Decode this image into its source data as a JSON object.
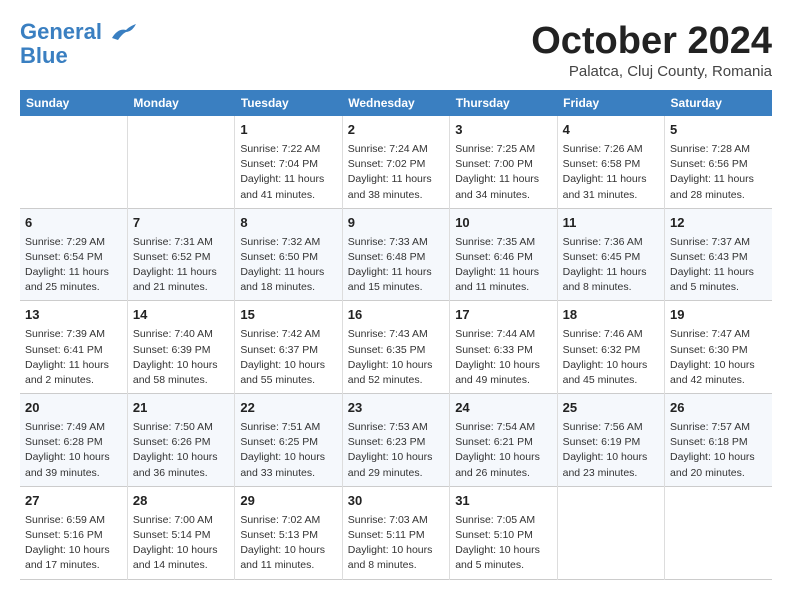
{
  "header": {
    "logo_line1": "General",
    "logo_line2": "Blue",
    "month": "October 2024",
    "location": "Palatca, Cluj County, Romania"
  },
  "weekdays": [
    "Sunday",
    "Monday",
    "Tuesday",
    "Wednesday",
    "Thursday",
    "Friday",
    "Saturday"
  ],
  "weeks": [
    [
      {
        "day": "",
        "info": ""
      },
      {
        "day": "",
        "info": ""
      },
      {
        "day": "1",
        "info": "Sunrise: 7:22 AM\nSunset: 7:04 PM\nDaylight: 11 hours and 41 minutes."
      },
      {
        "day": "2",
        "info": "Sunrise: 7:24 AM\nSunset: 7:02 PM\nDaylight: 11 hours and 38 minutes."
      },
      {
        "day": "3",
        "info": "Sunrise: 7:25 AM\nSunset: 7:00 PM\nDaylight: 11 hours and 34 minutes."
      },
      {
        "day": "4",
        "info": "Sunrise: 7:26 AM\nSunset: 6:58 PM\nDaylight: 11 hours and 31 minutes."
      },
      {
        "day": "5",
        "info": "Sunrise: 7:28 AM\nSunset: 6:56 PM\nDaylight: 11 hours and 28 minutes."
      }
    ],
    [
      {
        "day": "6",
        "info": "Sunrise: 7:29 AM\nSunset: 6:54 PM\nDaylight: 11 hours and 25 minutes."
      },
      {
        "day": "7",
        "info": "Sunrise: 7:31 AM\nSunset: 6:52 PM\nDaylight: 11 hours and 21 minutes."
      },
      {
        "day": "8",
        "info": "Sunrise: 7:32 AM\nSunset: 6:50 PM\nDaylight: 11 hours and 18 minutes."
      },
      {
        "day": "9",
        "info": "Sunrise: 7:33 AM\nSunset: 6:48 PM\nDaylight: 11 hours and 15 minutes."
      },
      {
        "day": "10",
        "info": "Sunrise: 7:35 AM\nSunset: 6:46 PM\nDaylight: 11 hours and 11 minutes."
      },
      {
        "day": "11",
        "info": "Sunrise: 7:36 AM\nSunset: 6:45 PM\nDaylight: 11 hours and 8 minutes."
      },
      {
        "day": "12",
        "info": "Sunrise: 7:37 AM\nSunset: 6:43 PM\nDaylight: 11 hours and 5 minutes."
      }
    ],
    [
      {
        "day": "13",
        "info": "Sunrise: 7:39 AM\nSunset: 6:41 PM\nDaylight: 11 hours and 2 minutes."
      },
      {
        "day": "14",
        "info": "Sunrise: 7:40 AM\nSunset: 6:39 PM\nDaylight: 10 hours and 58 minutes."
      },
      {
        "day": "15",
        "info": "Sunrise: 7:42 AM\nSunset: 6:37 PM\nDaylight: 10 hours and 55 minutes."
      },
      {
        "day": "16",
        "info": "Sunrise: 7:43 AM\nSunset: 6:35 PM\nDaylight: 10 hours and 52 minutes."
      },
      {
        "day": "17",
        "info": "Sunrise: 7:44 AM\nSunset: 6:33 PM\nDaylight: 10 hours and 49 minutes."
      },
      {
        "day": "18",
        "info": "Sunrise: 7:46 AM\nSunset: 6:32 PM\nDaylight: 10 hours and 45 minutes."
      },
      {
        "day": "19",
        "info": "Sunrise: 7:47 AM\nSunset: 6:30 PM\nDaylight: 10 hours and 42 minutes."
      }
    ],
    [
      {
        "day": "20",
        "info": "Sunrise: 7:49 AM\nSunset: 6:28 PM\nDaylight: 10 hours and 39 minutes."
      },
      {
        "day": "21",
        "info": "Sunrise: 7:50 AM\nSunset: 6:26 PM\nDaylight: 10 hours and 36 minutes."
      },
      {
        "day": "22",
        "info": "Sunrise: 7:51 AM\nSunset: 6:25 PM\nDaylight: 10 hours and 33 minutes."
      },
      {
        "day": "23",
        "info": "Sunrise: 7:53 AM\nSunset: 6:23 PM\nDaylight: 10 hours and 29 minutes."
      },
      {
        "day": "24",
        "info": "Sunrise: 7:54 AM\nSunset: 6:21 PM\nDaylight: 10 hours and 26 minutes."
      },
      {
        "day": "25",
        "info": "Sunrise: 7:56 AM\nSunset: 6:19 PM\nDaylight: 10 hours and 23 minutes."
      },
      {
        "day": "26",
        "info": "Sunrise: 7:57 AM\nSunset: 6:18 PM\nDaylight: 10 hours and 20 minutes."
      }
    ],
    [
      {
        "day": "27",
        "info": "Sunrise: 6:59 AM\nSunset: 5:16 PM\nDaylight: 10 hours and 17 minutes."
      },
      {
        "day": "28",
        "info": "Sunrise: 7:00 AM\nSunset: 5:14 PM\nDaylight: 10 hours and 14 minutes."
      },
      {
        "day": "29",
        "info": "Sunrise: 7:02 AM\nSunset: 5:13 PM\nDaylight: 10 hours and 11 minutes."
      },
      {
        "day": "30",
        "info": "Sunrise: 7:03 AM\nSunset: 5:11 PM\nDaylight: 10 hours and 8 minutes."
      },
      {
        "day": "31",
        "info": "Sunrise: 7:05 AM\nSunset: 5:10 PM\nDaylight: 10 hours and 5 minutes."
      },
      {
        "day": "",
        "info": ""
      },
      {
        "day": "",
        "info": ""
      }
    ]
  ]
}
